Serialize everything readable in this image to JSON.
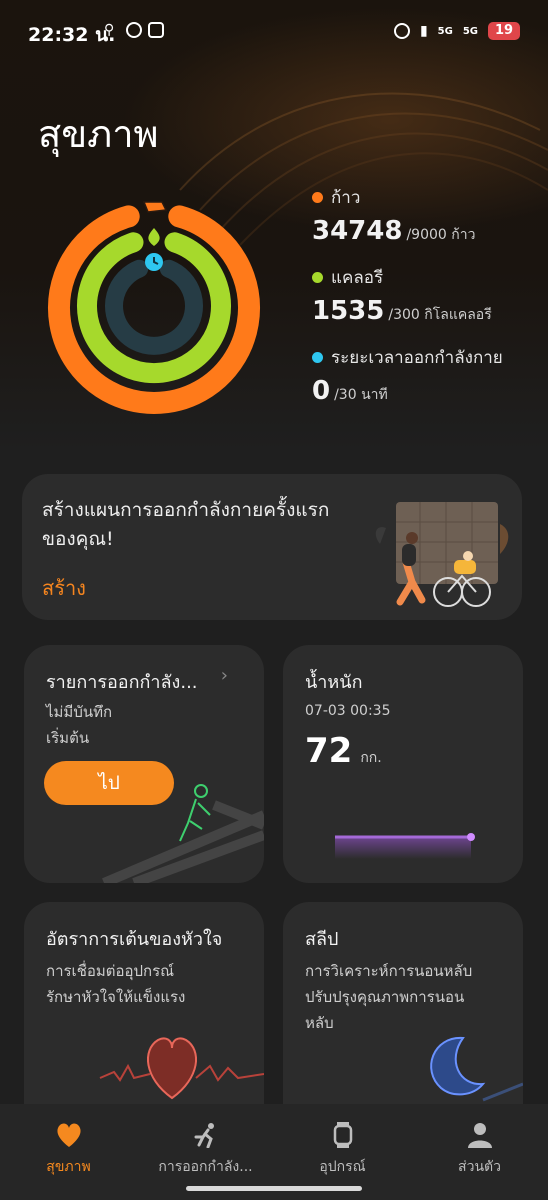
{
  "status_bar": {
    "time": "22:32 น.",
    "network_1": "5G",
    "network_2": "5G",
    "battery": "19"
  },
  "page_title": "สุขภาพ",
  "activity": {
    "steps": {
      "label": "ก้าว",
      "value": "34748",
      "goal": "/9000 ก้าว",
      "color": "#ff7a1a"
    },
    "calories": {
      "label": "แคลอรี",
      "value": "1535",
      "goal": "/300 กิโลแคลอรี",
      "color": "#a6d92c"
    },
    "exercise": {
      "label": "ระยะเวลาออกกำลังกาย",
      "value": "0",
      "goal": "/30 นาที",
      "color": "#2ec7f0"
    }
  },
  "plan_card": {
    "text": "สร้างแผนการออกกำลังกายครั้งแรกของคุณ!",
    "action": "สร้าง"
  },
  "workout_card": {
    "title": "รายการออกกำลัง...",
    "line1": "ไม่มีบันทึก",
    "line2": "เริ่มต้น",
    "button": "ไป"
  },
  "weight_card": {
    "title": "น้ำหนัก",
    "date": "07-03 00:35",
    "value": "72",
    "unit": "กก."
  },
  "heart_card": {
    "title": "อัตราการเต้นของหัวใจ",
    "line1": "การเชื่อมต่ออุปกรณ์",
    "line2": "รักษาหัวใจให้แข็งแรง"
  },
  "sleep_card": {
    "title": "สลีป",
    "line1": "การวิเคราะห์การนอนหลับ",
    "line2": "ปรับปรุงคุณภาพการนอน",
    "line3": "หลับ"
  },
  "bottom_nav": [
    {
      "label": "สุขภาพ",
      "icon": "heart-icon",
      "active": true
    },
    {
      "label": "การออกกำลัง...",
      "icon": "runner-icon",
      "active": false
    },
    {
      "label": "อุปกรณ์",
      "icon": "watch-icon",
      "active": false
    },
    {
      "label": "ส่วนตัว",
      "icon": "person-icon",
      "active": false
    }
  ],
  "colors": {
    "accent": "#f5891f",
    "card": "#2c2c2c",
    "background": "#1f1f1f"
  }
}
